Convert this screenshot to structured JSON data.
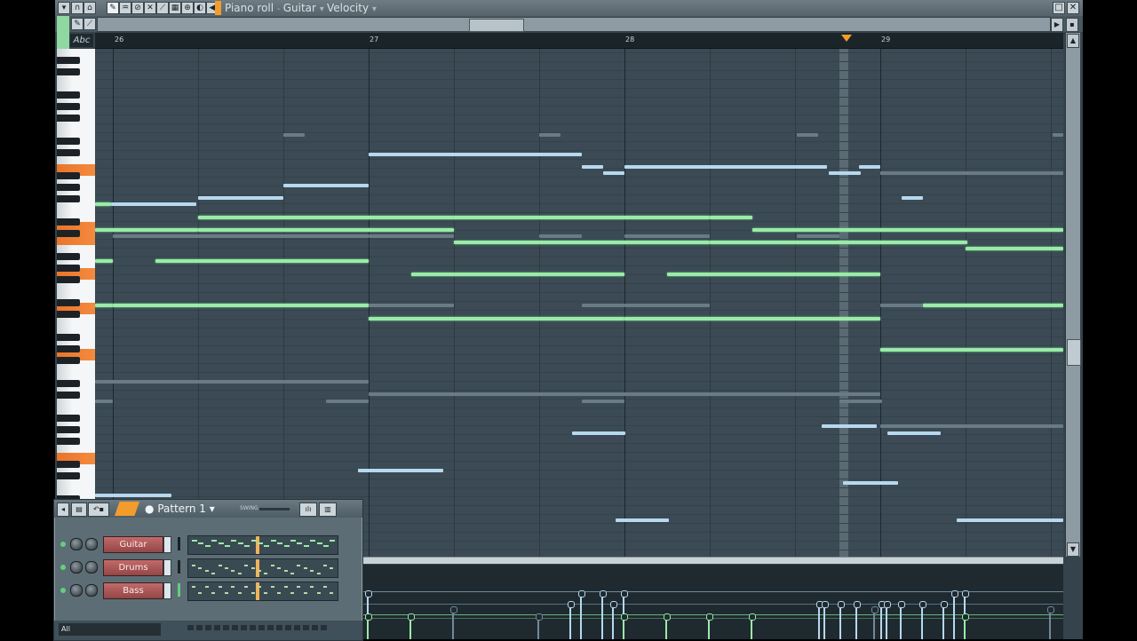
{
  "window": {
    "title_parts": [
      "Piano roll",
      "Guitar",
      "Velocity"
    ]
  },
  "ruler": {
    "bars": [
      "26",
      "27",
      "28",
      "29"
    ]
  },
  "abc_label": "Abc",
  "channel_rack": {
    "pattern": "Pattern 1",
    "swing_label": "SWING",
    "channels": [
      {
        "name": "Guitar"
      },
      {
        "name": "Drums"
      },
      {
        "name": "Bass"
      }
    ],
    "filter": "All"
  },
  "colors": {
    "accent": "#f39c2b",
    "note_green": "#9beaa8",
    "note_blue": "#b7d8ee",
    "channel_button": "#b35c5c"
  }
}
